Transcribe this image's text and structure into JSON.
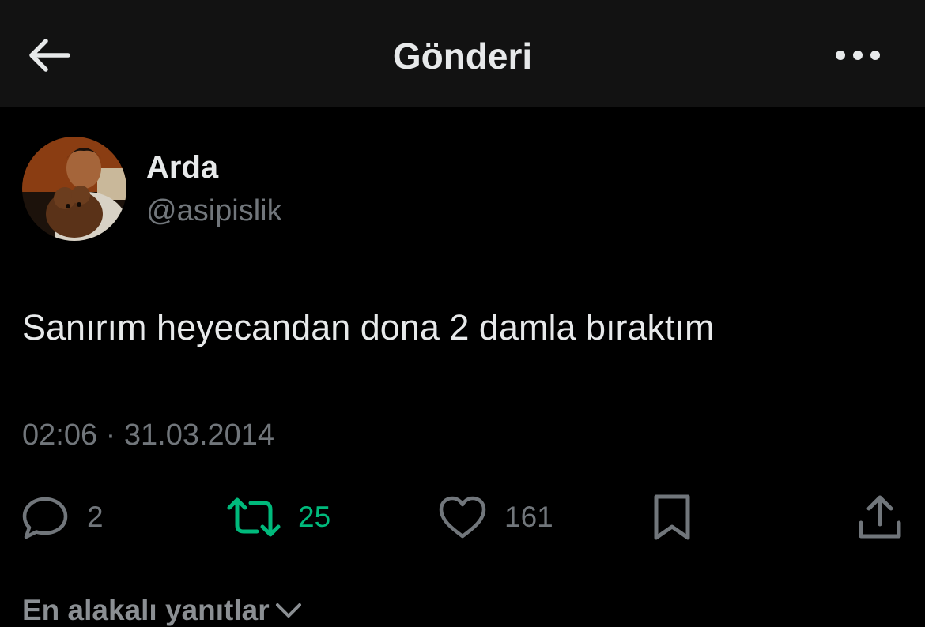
{
  "header": {
    "title": "Gönderi",
    "back_icon": "arrow-left-icon",
    "more_icon": "more-horizontal-icon"
  },
  "author": {
    "display_name": "Arda",
    "handle": "@asipislik"
  },
  "tweet": {
    "text": "Sanırım heyecandan dona 2 damla bıraktım",
    "timestamp": "02:06 · 31.03.2014"
  },
  "actions": {
    "reply_count": "2",
    "retweet_count": "25",
    "like_count": "161"
  },
  "replies": {
    "sort_label": "En alakalı yanıtlar"
  },
  "colors": {
    "background": "#000000",
    "header_bg": "#121212",
    "text_primary": "#e7e9ea",
    "text_secondary": "#71767b",
    "retweet_active": "#00ba7c"
  }
}
